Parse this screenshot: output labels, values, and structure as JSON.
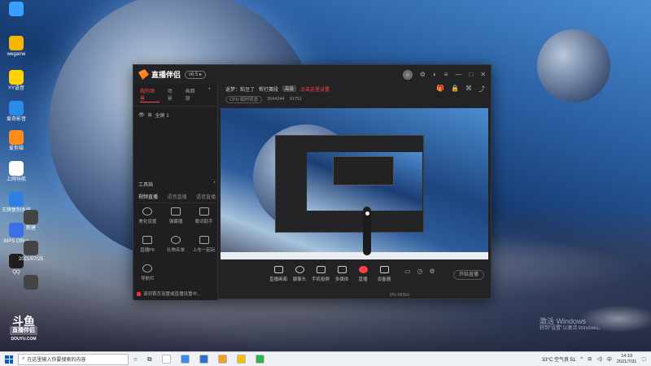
{
  "desktop": {
    "icons": [
      {
        "label": "",
        "color": "#3aa0ff"
      },
      {
        "label": "wegame",
        "color": "#f5b600"
      },
      {
        "label": "YY语音",
        "color": "#ffd200"
      },
      {
        "label": "爱奇影音",
        "color": "#2a8be8"
      },
      {
        "label": "爱剪辑",
        "color": "#ff8c1a"
      },
      {
        "label": "上网导航",
        "color": "#ffffff"
      },
      {
        "label": "王牌复制系统",
        "color": "#2d7fe0"
      },
      {
        "label": "WPS Office",
        "color": "#3b6fe8"
      },
      {
        "label": "QQ",
        "color": "#1e1e1e"
      },
      {
        "label": "新建",
        "color": "#444444"
      },
      {
        "label": "2021/07/25",
        "color": "#444444"
      },
      {
        "label": "",
        "color": "#444444"
      }
    ],
    "watermark": {
      "line1": "斗鱼",
      "line2": "直播伴侣",
      "line3": "DOUYU.COM"
    },
    "activation": {
      "title": "激活 Windows",
      "sub": "转到\"设置\"以激活 Windows。"
    }
  },
  "app": {
    "version_badge": "v6.5 ▸",
    "left": {
      "tabs": [
        "我的场景",
        "场景",
        "画面源"
      ],
      "scene_name": "全屏 1",
      "section_title": "工具箱",
      "tool_tabs": [
        "视频直播",
        "语音直播",
        "语音直播"
      ],
      "tools": [
        "美化设置",
        "弹幕播",
        "歌词助手",
        "直播PK",
        "礼物名单",
        "上车一起玩",
        "导航栏"
      ],
      "bottom_msg": "请到首页设置或直播设置中..."
    },
    "main": {
      "info_line": [
        "返梦：粘豆了",
        "帮打赛段",
        "高级",
        "点击这里设置"
      ],
      "stats": [
        "CPU 临时状态",
        "3544344",
        "31751"
      ],
      "toolbar": [
        "直播画面",
        "摄像头",
        "手机投屏",
        "多媒体",
        "直播",
        "设备器"
      ],
      "start_live": "开始直播",
      "status": "0%  0KB/s"
    }
  },
  "taskbar": {
    "search_placeholder": "在这里输入你要搜索的内容",
    "apps": [
      {
        "color": "#ffffff"
      },
      {
        "color": "#3a8ee6"
      },
      {
        "color": "#2b6fd1"
      },
      {
        "color": "#f0a020"
      },
      {
        "color": "#f5c000"
      },
      {
        "color": "#2fb34c"
      }
    ],
    "weather": "33°C 空气良 51",
    "time": "14:19",
    "date": "2021/7/31"
  }
}
